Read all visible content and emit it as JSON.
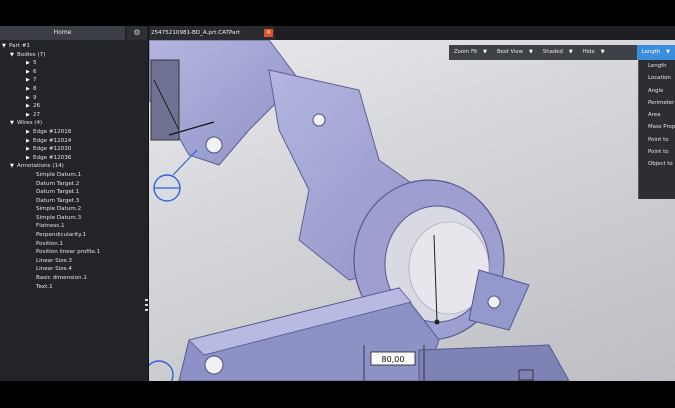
{
  "left_panel": {
    "home_tab": "Home",
    "tree": [
      {
        "label": "Part #1",
        "level": 0,
        "expanded": true
      },
      {
        "label": "Bodies (7)",
        "level": 1,
        "expanded": true
      },
      {
        "label": "5",
        "level": 2,
        "expanded": false
      },
      {
        "label": "6",
        "level": 2,
        "expanded": false
      },
      {
        "label": "7",
        "level": 2,
        "expanded": false
      },
      {
        "label": "8",
        "level": 2,
        "expanded": false
      },
      {
        "label": "9",
        "level": 2,
        "expanded": false
      },
      {
        "label": "26",
        "level": 2,
        "expanded": false
      },
      {
        "label": "27",
        "level": 2,
        "expanded": false
      },
      {
        "label": "Wires (4)",
        "level": 1,
        "expanded": true
      },
      {
        "label": "Edge #12018",
        "level": 2,
        "expanded": false
      },
      {
        "label": "Edge #12024",
        "level": 2,
        "expanded": false
      },
      {
        "label": "Edge #12030",
        "level": 2,
        "expanded": false
      },
      {
        "label": "Edge #12036",
        "level": 2,
        "expanded": false
      },
      {
        "label": "Annotations (14)",
        "level": 1,
        "expanded": true
      },
      {
        "label": "Simple Datum.1",
        "level": 3
      },
      {
        "label": "Datum Target.2",
        "level": 3
      },
      {
        "label": "Datum Target.1",
        "level": 3
      },
      {
        "label": "Datum Target.3",
        "level": 3
      },
      {
        "label": "Simple Datum.2",
        "level": 3
      },
      {
        "label": "Simple Datum.3",
        "level": 3
      },
      {
        "label": "Flatness.1",
        "level": 3
      },
      {
        "label": "Perpendicularity.1",
        "level": 3
      },
      {
        "label": "Position.1",
        "level": 3
      },
      {
        "label": "Position linear profile.1",
        "level": 3
      },
      {
        "label": "Linear Size.3",
        "level": 3
      },
      {
        "label": "Linear Size.4",
        "level": 3
      },
      {
        "label": "Basic dimension.1",
        "level": 3
      },
      {
        "label": "Text.1",
        "level": 3
      }
    ]
  },
  "document_tab": {
    "label": "25475210981-BD_A.prt.CATPart"
  },
  "toolbar": {
    "zoom_fit": "Zoom Fit",
    "best_view": "Best View",
    "shaded": "Shaded",
    "hide": "Hide",
    "length": "Length"
  },
  "measure_menu": [
    "Length",
    "Location",
    "Angle",
    "Perimeter",
    "Area",
    "Mass Prop",
    "Point to",
    "Point to",
    "Object to"
  ],
  "dimension_label": "80,00",
  "colors": {
    "part": "#a4a6d4",
    "part_shadow": "#7d80b2",
    "accent": "#3a8edc",
    "annotation": "#2d62d8"
  }
}
